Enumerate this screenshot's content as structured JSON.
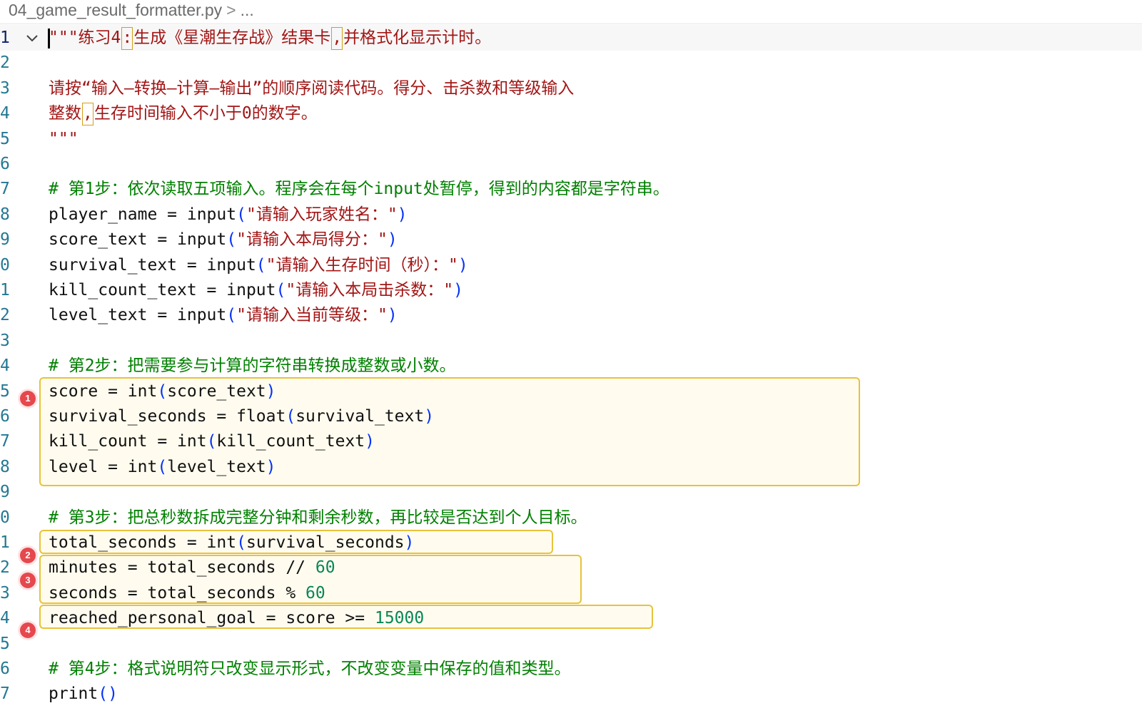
{
  "breadcrumb": {
    "file": "04_game_result_formatter.py",
    "more": "..."
  },
  "lines": [
    {
      "n": "1",
      "segs": [
        {
          "t": "\"\"\"练习4",
          "c": "str"
        },
        {
          "t": ":",
          "c": "str ctrl"
        },
        {
          "t": "生成《星潮生存战》结果卡",
          "c": "str"
        },
        {
          "t": ",",
          "c": "str ctrl"
        },
        {
          "t": "并格式化显示计时。",
          "c": "str"
        }
      ]
    },
    {
      "n": "2",
      "segs": []
    },
    {
      "n": "3",
      "segs": [
        {
          "t": "请按“输入—转换—计算—输出”的顺序阅读代码。得分、击杀数和等级输入",
          "c": "str"
        }
      ]
    },
    {
      "n": "4",
      "segs": [
        {
          "t": "整数",
          "c": "str"
        },
        {
          "t": ",",
          "c": "str ctrl"
        },
        {
          "t": "生存时间输入不小于0的数字。",
          "c": "str"
        }
      ]
    },
    {
      "n": "5",
      "segs": [
        {
          "t": "\"\"\"",
          "c": "str"
        }
      ]
    },
    {
      "n": "6",
      "segs": []
    },
    {
      "n": "7",
      "segs": [
        {
          "t": "# 第1步：依次读取五项输入。程序会在每个input处暂停，得到的内容都是字符串。",
          "c": "cmt"
        }
      ]
    },
    {
      "n": "8",
      "segs": [
        {
          "t": "player_name = input",
          "c": ""
        },
        {
          "t": "(",
          "c": "par"
        },
        {
          "t": "\"请输入玩家姓名：\"",
          "c": "str"
        },
        {
          "t": ")",
          "c": "par"
        }
      ]
    },
    {
      "n": "9",
      "segs": [
        {
          "t": "score_text = input",
          "c": ""
        },
        {
          "t": "(",
          "c": "par"
        },
        {
          "t": "\"请输入本局得分：\"",
          "c": "str"
        },
        {
          "t": ")",
          "c": "par"
        }
      ]
    },
    {
      "n": "0",
      "segs": [
        {
          "t": "survival_text = input",
          "c": ""
        },
        {
          "t": "(",
          "c": "par"
        },
        {
          "t": "\"请输入生存时间（秒）：\"",
          "c": "str"
        },
        {
          "t": ")",
          "c": "par"
        }
      ]
    },
    {
      "n": "1",
      "segs": [
        {
          "t": "kill_count_text = input",
          "c": ""
        },
        {
          "t": "(",
          "c": "par"
        },
        {
          "t": "\"请输入本局击杀数：\"",
          "c": "str"
        },
        {
          "t": ")",
          "c": "par"
        }
      ]
    },
    {
      "n": "2",
      "segs": [
        {
          "t": "level_text = input",
          "c": ""
        },
        {
          "t": "(",
          "c": "par"
        },
        {
          "t": "\"请输入当前等级：\"",
          "c": "str"
        },
        {
          "t": ")",
          "c": "par"
        }
      ]
    },
    {
      "n": "3",
      "segs": []
    },
    {
      "n": "4",
      "segs": [
        {
          "t": "# 第2步：把需要参与计算的字符串转换成整数或小数。",
          "c": "cmt"
        }
      ]
    },
    {
      "n": "5",
      "segs": [
        {
          "t": "score = int",
          "c": ""
        },
        {
          "t": "(",
          "c": "par"
        },
        {
          "t": "score_text",
          "c": ""
        },
        {
          "t": ")",
          "c": "par"
        }
      ]
    },
    {
      "n": "6",
      "segs": [
        {
          "t": "survival_seconds = float",
          "c": ""
        },
        {
          "t": "(",
          "c": "par"
        },
        {
          "t": "survival_text",
          "c": ""
        },
        {
          "t": ")",
          "c": "par"
        }
      ]
    },
    {
      "n": "7",
      "segs": [
        {
          "t": "kill_count = int",
          "c": ""
        },
        {
          "t": "(",
          "c": "par"
        },
        {
          "t": "kill_count_text",
          "c": ""
        },
        {
          "t": ")",
          "c": "par"
        }
      ]
    },
    {
      "n": "8",
      "segs": [
        {
          "t": "level = int",
          "c": ""
        },
        {
          "t": "(",
          "c": "par"
        },
        {
          "t": "level_text",
          "c": ""
        },
        {
          "t": ")",
          "c": "par"
        }
      ]
    },
    {
      "n": "9",
      "segs": []
    },
    {
      "n": "0",
      "segs": [
        {
          "t": "# 第3步：把总秒数拆成完整分钟和剩余秒数，再比较是否达到个人目标。",
          "c": "cmt"
        }
      ]
    },
    {
      "n": "1",
      "segs": [
        {
          "t": "total_seconds = int",
          "c": ""
        },
        {
          "t": "(",
          "c": "par"
        },
        {
          "t": "survival_seconds",
          "c": ""
        },
        {
          "t": ")",
          "c": "par"
        }
      ]
    },
    {
      "n": "2",
      "segs": [
        {
          "t": "minutes = total_seconds // ",
          "c": ""
        },
        {
          "t": "60",
          "c": "num"
        }
      ]
    },
    {
      "n": "3",
      "segs": [
        {
          "t": "seconds = total_seconds % ",
          "c": ""
        },
        {
          "t": "60",
          "c": "num"
        }
      ]
    },
    {
      "n": "4",
      "segs": [
        {
          "t": "reached_personal_goal = score >= ",
          "c": ""
        },
        {
          "t": "15000",
          "c": "num"
        }
      ]
    },
    {
      "n": "5",
      "segs": []
    },
    {
      "n": "6",
      "segs": [
        {
          "t": "# 第4步：格式说明符只改变显示形式，不改变变量中保存的值和类型。",
          "c": "cmt"
        }
      ]
    },
    {
      "n": "7",
      "segs": [
        {
          "t": "print",
          "c": ""
        },
        {
          "t": "()",
          "c": "par"
        }
      ]
    }
  ],
  "badges": [
    "1",
    "2",
    "3",
    "4"
  ],
  "colors": {
    "string": "#a31515",
    "comment": "#008000",
    "number": "#098658",
    "paren": "#0431fa",
    "highlight": "#e8c23a",
    "badge": "#e5484d"
  }
}
